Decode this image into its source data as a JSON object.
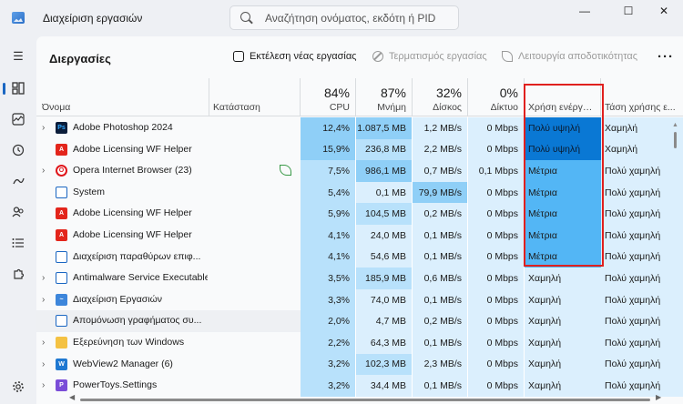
{
  "app": {
    "title": "Διαχείριση εργασιών"
  },
  "search": {
    "placeholder": "Αναζήτηση ονόματος, εκδότη ή PID"
  },
  "window_controls": {
    "minimize": "—",
    "maximize": "☐",
    "close": "✕"
  },
  "commandbar": {
    "title": "Διεργασίες",
    "run_new_task": "Εκτέλεση νέας εργασίας",
    "end_task": "Τερματισμός εργασίας",
    "efficiency_mode": "Λειτουργία αποδοτικότητας",
    "more": "···"
  },
  "columns": {
    "name": "Όνομα",
    "status": "Κατάσταση",
    "cpu": {
      "pct": "84%",
      "label": "CPU"
    },
    "memory": {
      "pct": "87%",
      "label": "Μνήμη"
    },
    "disk": {
      "pct": "32%",
      "label": "Δίσκος"
    },
    "network": {
      "pct": "0%",
      "label": "Δίκτυο"
    },
    "power_usage": "Χρήση ενέργει...",
    "power_trend": "Τάση χρήσης ε..."
  },
  "processes": [
    {
      "name": "Adobe Photoshop 2024",
      "icon": "photoshop-icon",
      "expandable": true,
      "status": "",
      "cpu": "12,4%",
      "memory": "1.087,5 MB",
      "disk": "1,2 MB/s",
      "network": "0 Mbps",
      "power": "Πολύ υψηλή",
      "power_trend": "Χαμηλή"
    },
    {
      "name": "Adobe Licensing WF Helper",
      "icon": "adobe-icon",
      "expandable": false,
      "status": "",
      "cpu": "15,9%",
      "memory": "236,8 MB",
      "disk": "2,2 MB/s",
      "network": "0 Mbps",
      "power": "Πολύ υψηλή",
      "power_trend": "Χαμηλή"
    },
    {
      "name": "Opera Internet Browser (23)",
      "icon": "opera-icon",
      "expandable": true,
      "status": "efficiency",
      "cpu": "7,5%",
      "memory": "986,1 MB",
      "disk": "0,7 MB/s",
      "network": "0,1 Mbps",
      "power": "Μέτρια",
      "power_trend": "Πολύ χαμηλή"
    },
    {
      "name": "System",
      "icon": "system-icon",
      "expandable": false,
      "status": "",
      "cpu": "5,4%",
      "memory": "0,1 MB",
      "disk": "79,9 MB/s",
      "network": "0 Mbps",
      "power": "Μέτρια",
      "power_trend": "Πολύ χαμηλή"
    },
    {
      "name": "Adobe Licensing WF Helper",
      "icon": "adobe-icon",
      "expandable": false,
      "status": "",
      "cpu": "5,9%",
      "memory": "104,5 MB",
      "disk": "0,2 MB/s",
      "network": "0 Mbps",
      "power": "Μέτρια",
      "power_trend": "Πολύ χαμηλή"
    },
    {
      "name": "Adobe Licensing WF Helper",
      "icon": "adobe-icon",
      "expandable": false,
      "status": "",
      "cpu": "4,1%",
      "memory": "24,0 MB",
      "disk": "0,1 MB/s",
      "network": "0 Mbps",
      "power": "Μέτρια",
      "power_trend": "Πολύ χαμηλή"
    },
    {
      "name": "Διαχείριση παραθύρων επιφ...",
      "icon": "window-icon",
      "expandable": false,
      "status": "",
      "cpu": "4,1%",
      "memory": "54,6 MB",
      "disk": "0,1 MB/s",
      "network": "0 Mbps",
      "power": "Μέτρια",
      "power_trend": "Πολύ χαμηλή"
    },
    {
      "name": "Antimalware Service Executable",
      "icon": "window-icon",
      "expandable": true,
      "status": "",
      "cpu": "3,5%",
      "memory": "185,9 MB",
      "disk": "0,6 MB/s",
      "network": "0 Mbps",
      "power": "Χαμηλή",
      "power_trend": "Πολύ χαμηλή"
    },
    {
      "name": "Διαχείριση Εργασιών",
      "icon": "taskmgr-icon",
      "expandable": true,
      "status": "",
      "cpu": "3,3%",
      "memory": "74,0 MB",
      "disk": "0,1 MB/s",
      "network": "0 Mbps",
      "power": "Χαμηλή",
      "power_trend": "Πολύ χαμηλή"
    },
    {
      "name": "Απομόνωση γραφήματος συ...",
      "icon": "window-icon",
      "expandable": false,
      "status": "",
      "cpu": "2,0%",
      "memory": "4,7 MB",
      "disk": "0,2 MB/s",
      "network": "0 Mbps",
      "power": "Χαμηλή",
      "power_trend": "Πολύ χαμηλή"
    },
    {
      "name": "Εξερεύνηση των Windows",
      "icon": "folder-icon",
      "expandable": true,
      "status": "",
      "cpu": "2,2%",
      "memory": "64,3 MB",
      "disk": "0,1 MB/s",
      "network": "0 Mbps",
      "power": "Χαμηλή",
      "power_trend": "Πολύ χαμηλή"
    },
    {
      "name": "WebView2 Manager (6)",
      "icon": "webview-icon",
      "expandable": true,
      "status": "",
      "cpu": "3,2%",
      "memory": "102,3 MB",
      "disk": "2,3 MB/s",
      "network": "0 Mbps",
      "power": "Χαμηλή",
      "power_trend": "Πολύ χαμηλή"
    },
    {
      "name": "PowerToys.Settings",
      "icon": "powertoys-icon",
      "expandable": true,
      "status": "",
      "cpu": "3,2%",
      "memory": "34,4 MB",
      "disk": "0,1 MB/s",
      "network": "0 Mbps",
      "power": "Χαμηλή",
      "power_trend": "Πολύ χαμηλή"
    }
  ],
  "colors": {
    "accent": "#1a66c2",
    "highlight_box": "#e0201e",
    "power_very_high": "#0a78d4",
    "power_medium": "#53b6f5",
    "heat_light": "#dbeffd",
    "heat_mid": "#b8e1fb",
    "heat_strong": "#8fcff7"
  }
}
